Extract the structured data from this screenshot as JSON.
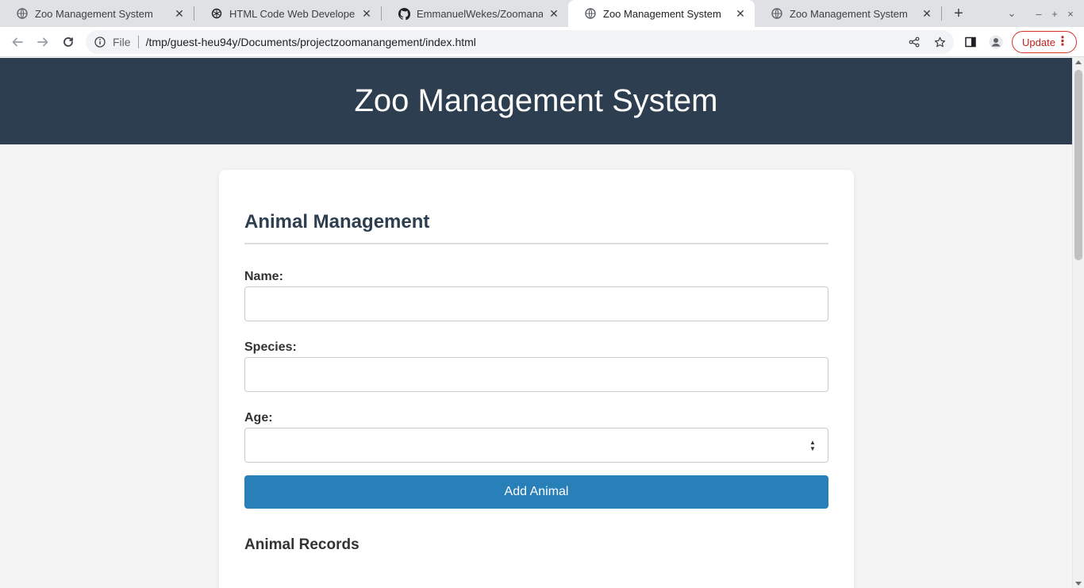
{
  "browser": {
    "tabs": [
      {
        "title": "Zoo Management System",
        "icon": "globe-icon",
        "active": false
      },
      {
        "title": "HTML Code Web Developer.",
        "icon": "openai-icon",
        "active": false
      },
      {
        "title": "EmmanuelWekes/Zoomanagement",
        "icon": "github-icon",
        "active": false
      },
      {
        "title": "Zoo Management System",
        "icon": "globe-icon",
        "active": true
      },
      {
        "title": "Zoo Management System",
        "icon": "globe-icon",
        "active": false
      }
    ],
    "address": {
      "scheme": "File",
      "url": "/tmp/guest-heu94y/Documents/projectzoomanangement/index.html"
    },
    "update_label": "Update"
  },
  "page": {
    "header_title": "Zoo Management System",
    "section_title": "Animal Management",
    "form": {
      "name_label": "Name:",
      "name_value": "",
      "species_label": "Species:",
      "species_value": "",
      "age_label": "Age:",
      "age_value": "",
      "submit_label": "Add Animal"
    },
    "records_title": "Animal Records"
  },
  "colors": {
    "header_bg": "#2c3e50",
    "button_bg": "#2980b9",
    "page_bg": "#f4f4f4",
    "update_accent": "#d93025"
  }
}
